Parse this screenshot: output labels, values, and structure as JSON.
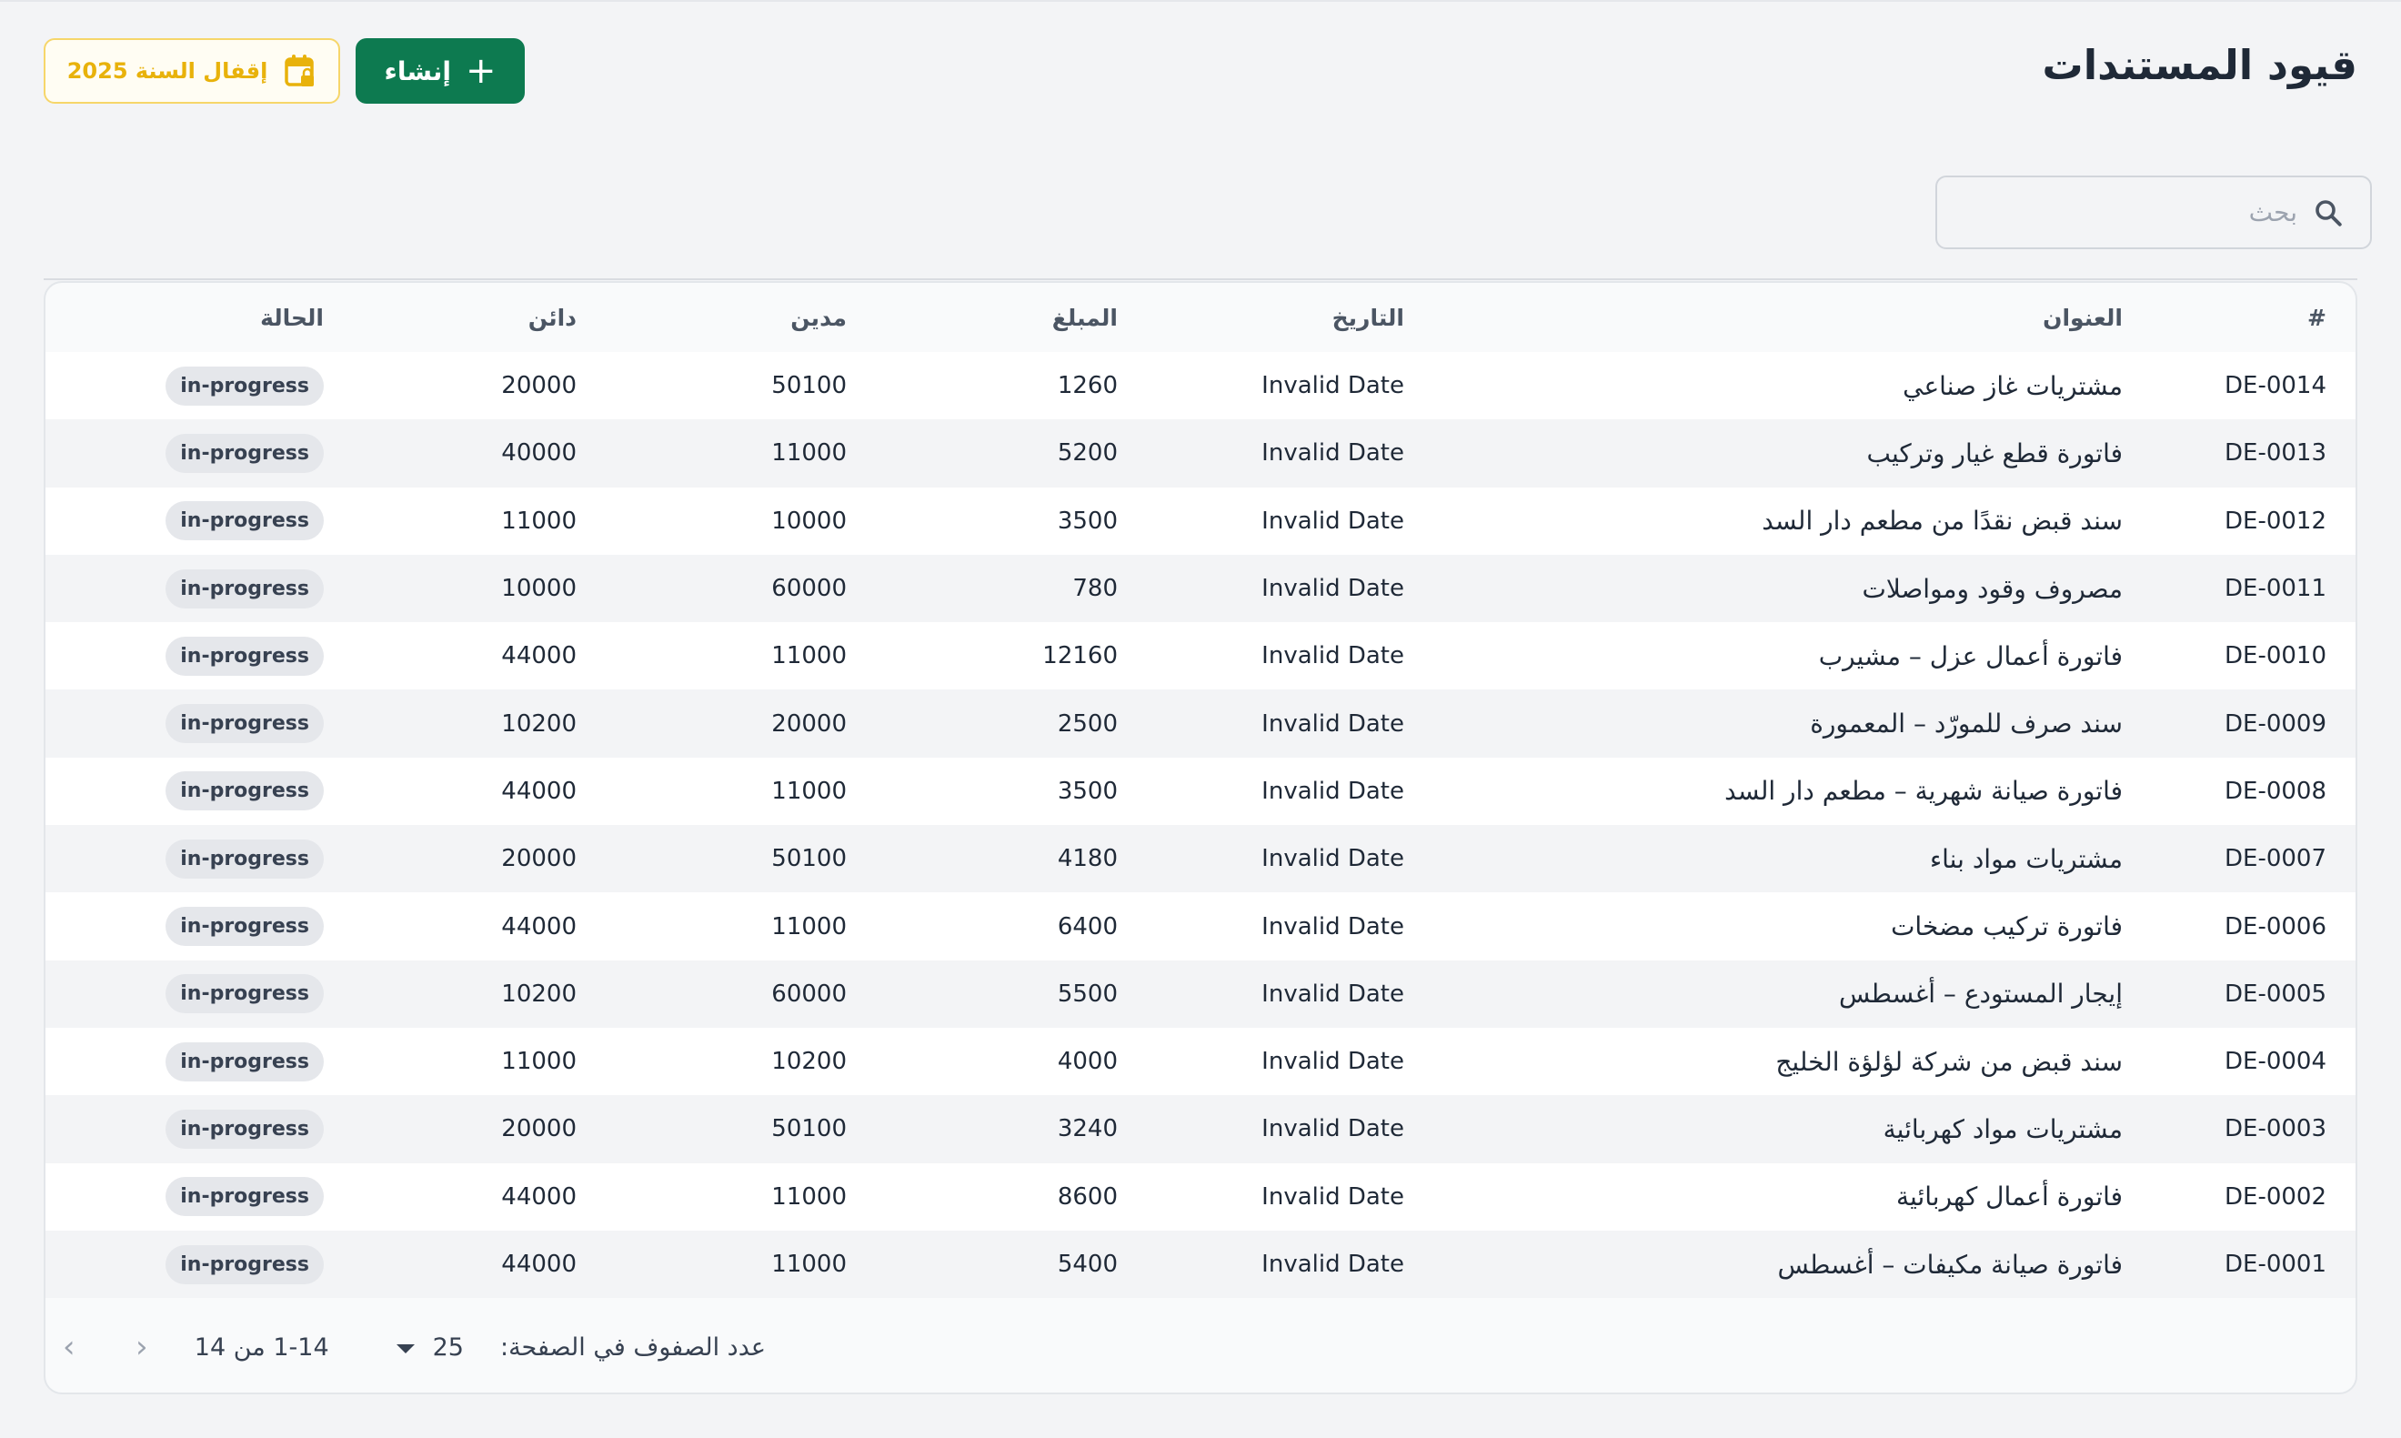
{
  "page": {
    "title": "قيود المستندات",
    "create_label": "إنشاء",
    "close_year_label": "إقفال السنة 2025",
    "search_placeholder": "بحث"
  },
  "table": {
    "columns": [
      "#",
      "العنوان",
      "التاريخ",
      "المبلغ",
      "مدين",
      "دائن",
      "الحالة"
    ],
    "rows": [
      {
        "id": "DE-0014",
        "title": "مشتريات غاز صناعي",
        "date": "Invalid Date",
        "amount": "1260",
        "debit": "50100",
        "credit": "20000",
        "status": "in-progress"
      },
      {
        "id": "DE-0013",
        "title": "فاتورة قطع غيار وتركيب",
        "date": "Invalid Date",
        "amount": "5200",
        "debit": "11000",
        "credit": "40000",
        "status": "in-progress"
      },
      {
        "id": "DE-0012",
        "title": "سند قبض نقدًا من مطعم دار السد",
        "date": "Invalid Date",
        "amount": "3500",
        "debit": "10000",
        "credit": "11000",
        "status": "in-progress"
      },
      {
        "id": "DE-0011",
        "title": "مصروف وقود ومواصلات",
        "date": "Invalid Date",
        "amount": "780",
        "debit": "60000",
        "credit": "10000",
        "status": "in-progress"
      },
      {
        "id": "DE-0010",
        "title": "فاتورة أعمال عزل – مشيرب",
        "date": "Invalid Date",
        "amount": "12160",
        "debit": "11000",
        "credit": "44000",
        "status": "in-progress"
      },
      {
        "id": "DE-0009",
        "title": "سند صرف للمورّد – المعمورة",
        "date": "Invalid Date",
        "amount": "2500",
        "debit": "20000",
        "credit": "10200",
        "status": "in-progress"
      },
      {
        "id": "DE-0008",
        "title": "فاتورة صيانة شهرية – مطعم دار السد",
        "date": "Invalid Date",
        "amount": "3500",
        "debit": "11000",
        "credit": "44000",
        "status": "in-progress"
      },
      {
        "id": "DE-0007",
        "title": "مشتريات مواد بناء",
        "date": "Invalid Date",
        "amount": "4180",
        "debit": "50100",
        "credit": "20000",
        "status": "in-progress"
      },
      {
        "id": "DE-0006",
        "title": "فاتورة تركيب مضخات",
        "date": "Invalid Date",
        "amount": "6400",
        "debit": "11000",
        "credit": "44000",
        "status": "in-progress"
      },
      {
        "id": "DE-0005",
        "title": "إيجار المستودع – أغسطس",
        "date": "Invalid Date",
        "amount": "5500",
        "debit": "60000",
        "credit": "10200",
        "status": "in-progress"
      },
      {
        "id": "DE-0004",
        "title": "سند قبض من شركة لؤلؤة الخليج",
        "date": "Invalid Date",
        "amount": "4000",
        "debit": "10200",
        "credit": "11000",
        "status": "in-progress"
      },
      {
        "id": "DE-0003",
        "title": "مشتريات مواد كهربائية",
        "date": "Invalid Date",
        "amount": "3240",
        "debit": "50100",
        "credit": "20000",
        "status": "in-progress"
      },
      {
        "id": "DE-0002",
        "title": "فاتورة أعمال كهربائية",
        "date": "Invalid Date",
        "amount": "8600",
        "debit": "11000",
        "credit": "44000",
        "status": "in-progress"
      },
      {
        "id": "DE-0001",
        "title": "فاتورة صيانة مكيفات – أغسطس",
        "date": "Invalid Date",
        "amount": "5400",
        "debit": "11000",
        "credit": "44000",
        "status": "in-progress"
      }
    ]
  },
  "pagination": {
    "rows_per_page_label": "عدد الصفوف في الصفحة:",
    "rows_per_page": "25",
    "range": "1-14 من 14"
  },
  "colors": {
    "primary": "#0d7a50",
    "warning": "#e8b20b"
  }
}
